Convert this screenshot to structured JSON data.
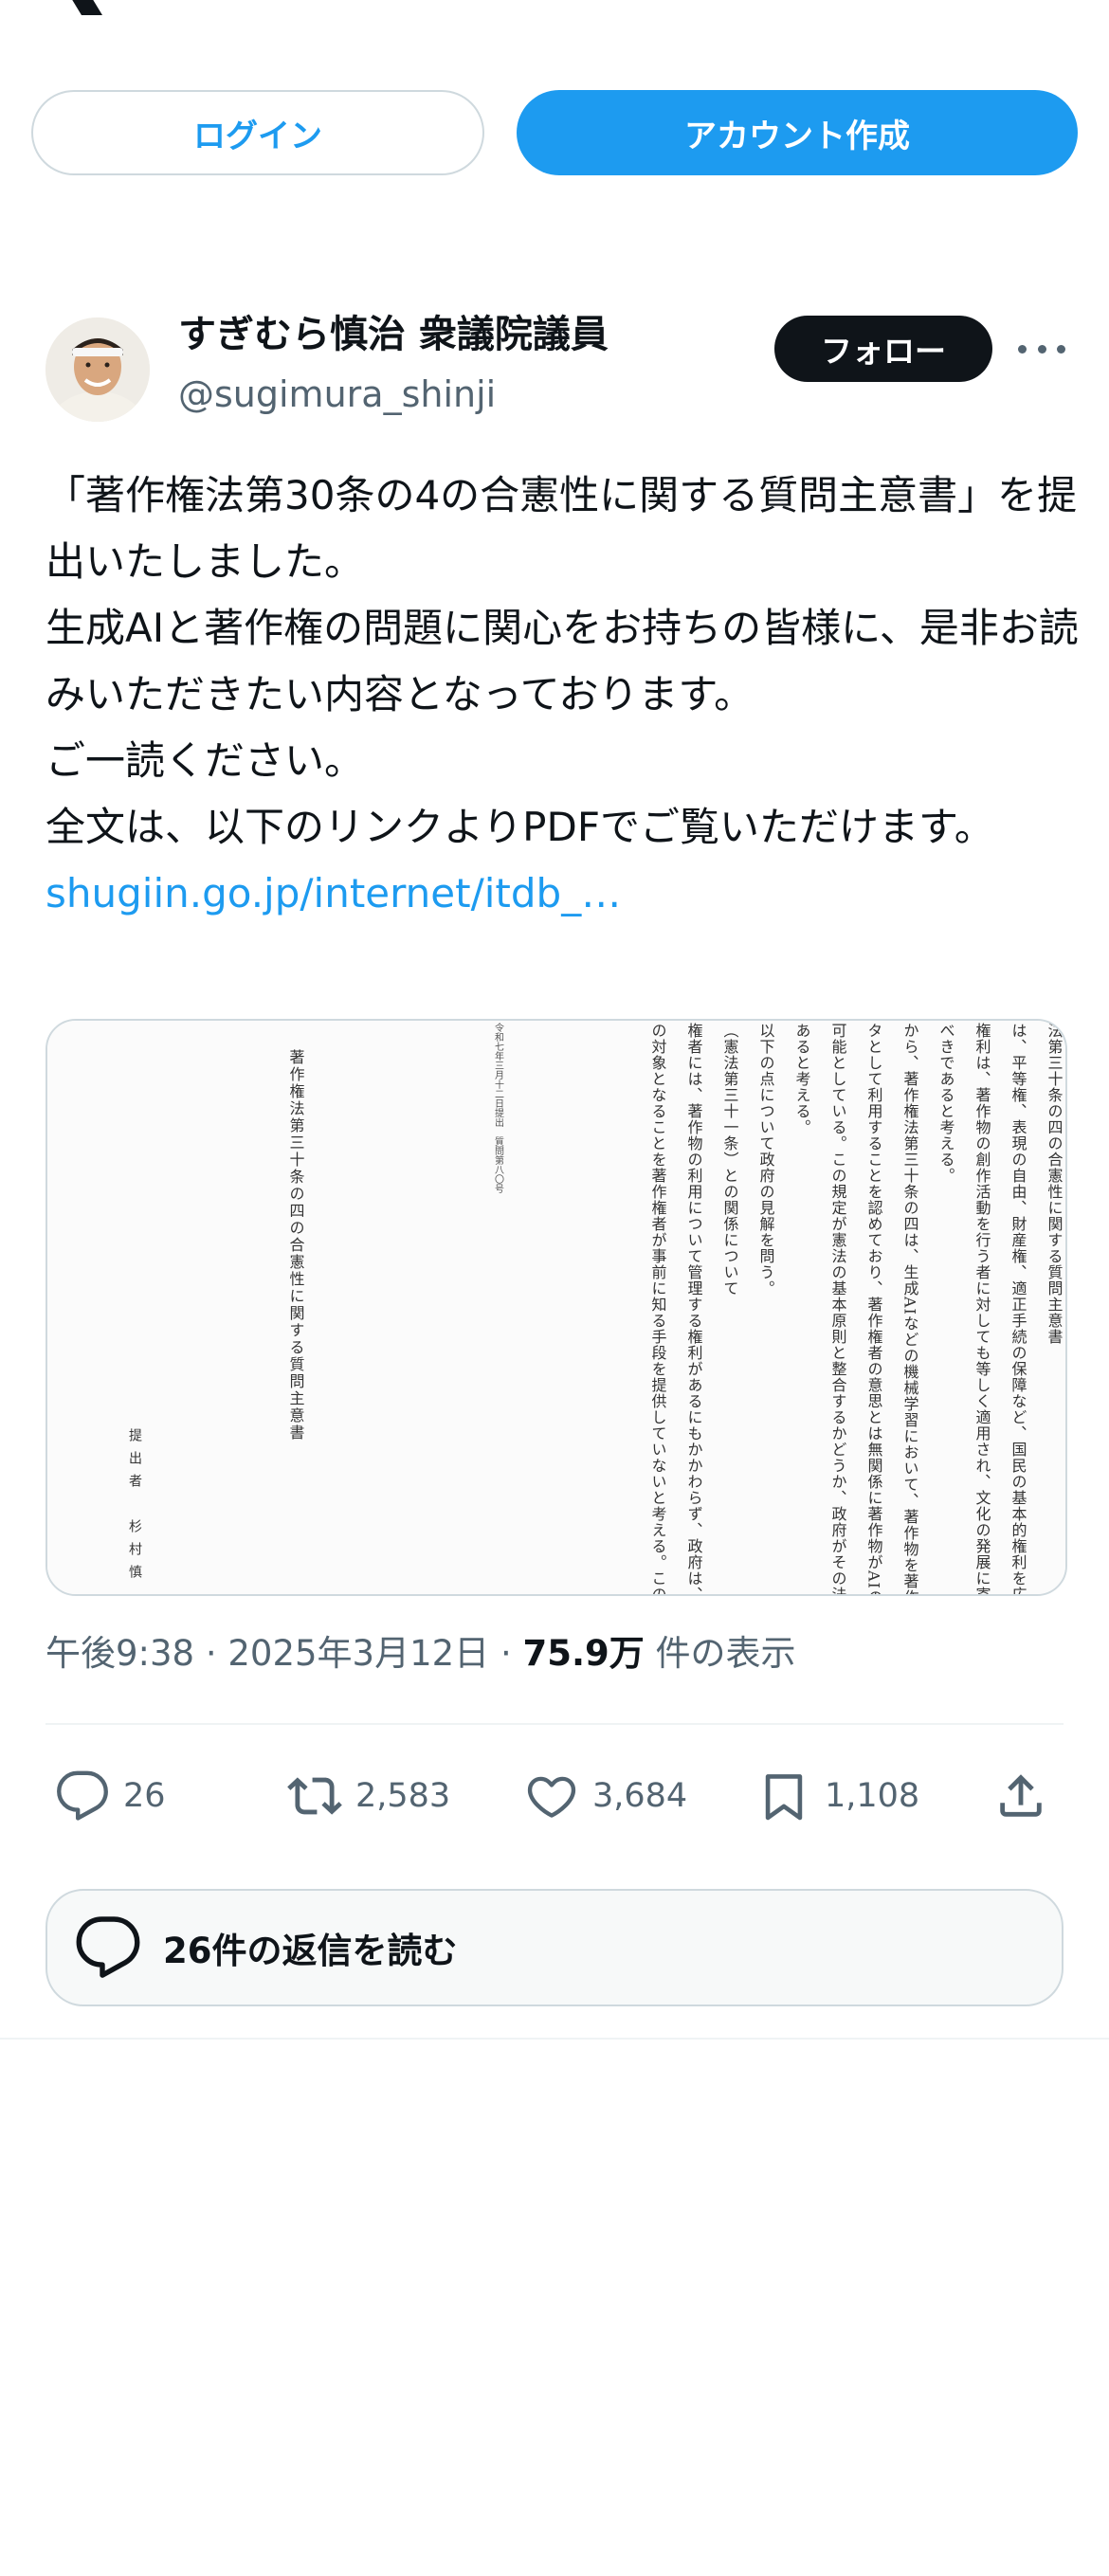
{
  "header": {
    "logo_icon": "x-logo-icon"
  },
  "auth": {
    "login_label": "ログイン",
    "signup_label": "アカウント作成"
  },
  "tweet": {
    "display_name": "すぎむら慎治 衆議院議員",
    "handle": "@sugimura_shinji",
    "follow_label": "フォロー",
    "text_lines": [
      "「著作権法第30条の4の合憲性に関する質問主意書」を提出いたしました。",
      "生成AIと著作権の問題に関心をお持ちの皆様に、是非お読みいただきたい内容となっております。",
      "ご一読ください。",
      "全文は、以下のリンクよりPDFでご覧いただけます。"
    ],
    "link_text": "shugiin.go.jp/internet/itdb_…",
    "document": {
      "title": "著作権法第三十条の四の合憲性に関する質問主意書",
      "submitter": "提出者　杉村慎",
      "columns": [
        "法第三十条の四の合憲性に関する質問主意書",
        "は、平等権、表現の自由、財産権、適正手続の保障など、国民の基本的権利を広範に保",
        "権利は、著作物の創作活動を行う者に対しても等しく適用され、文化の発展に寄与する",
        "べきであると考える。",
        "から、著作権法第三十条の四は、生成AIなどの機械学習において、著作物を著作権者の",
        "タとして利用することを認めており、著作権者の意思とは無関係に著作物がAIの学習",
        "可能としている。この規定が憲法の基本原則と整合するかどうか、政府がその法的正当性",
        "あると考える。",
        "以下の点について政府の見解を問う。",
        "（憲法第三十一条）との関係について",
        "権者には、著作物の利用について管理する権利があるにもかかわらず、政府は、自らの著",
        "の対象となることを著作権者が事前に知る手段を提供していないと考える。このことが"
      ],
      "header_note": "令和七年三月十二日提出　質問第八〇号"
    },
    "time": "午後9:38",
    "date": "2025年3月12日",
    "views_count": "75.9万",
    "views_label": "件の表示",
    "separator": "·",
    "actions": {
      "reply_count": "26",
      "retweet_count": "2,583",
      "like_count": "3,684",
      "bookmark_count": "1,108"
    },
    "read_replies_label": "26件の返信を読む"
  }
}
